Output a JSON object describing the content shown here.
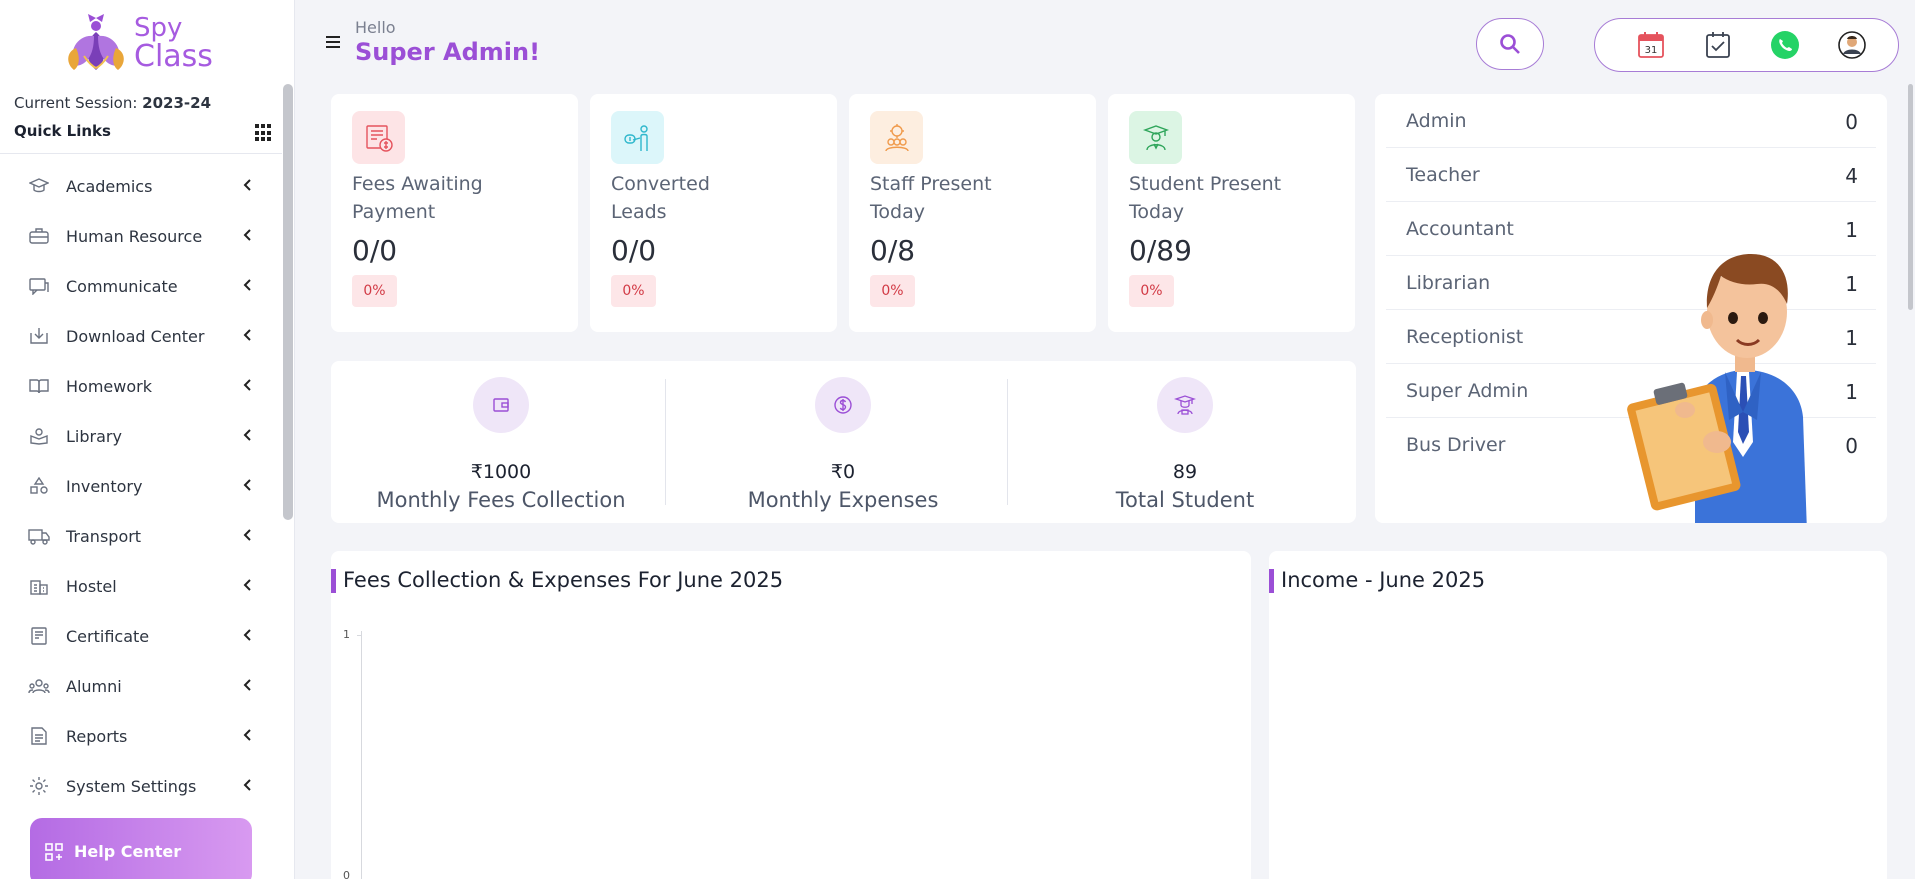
{
  "brand": {
    "line1": "Spy",
    "line2": "Class",
    "color": "#a65be0"
  },
  "session": {
    "label": "Current Session: ",
    "value": "2023-24"
  },
  "quick_links": "Quick Links",
  "menu": [
    {
      "label": "Academics",
      "icon": "graduation-cap-icon"
    },
    {
      "label": "Human Resource",
      "icon": "briefcase-icon"
    },
    {
      "label": "Communicate",
      "icon": "chat-icon"
    },
    {
      "label": "Download Center",
      "icon": "download-icon"
    },
    {
      "label": "Homework",
      "icon": "book-open-icon"
    },
    {
      "label": "Library",
      "icon": "library-icon"
    },
    {
      "label": "Inventory",
      "icon": "shapes-icon"
    },
    {
      "label": "Transport",
      "icon": "truck-icon"
    },
    {
      "label": "Hostel",
      "icon": "building-icon"
    },
    {
      "label": "Certificate",
      "icon": "certificate-icon"
    },
    {
      "label": "Alumni",
      "icon": "people-icon"
    },
    {
      "label": "Reports",
      "icon": "report-icon"
    },
    {
      "label": "System Settings",
      "icon": "gear-icon"
    }
  ],
  "help_center": "Help Center",
  "header": {
    "hello": "Hello",
    "user": "Super Admin!"
  },
  "toolbar": {
    "calendar_day": "31",
    "icons": [
      "calendar-icon",
      "task-check-icon",
      "whatsapp-icon",
      "user-avatar-icon"
    ]
  },
  "stats": [
    {
      "title_line1": "Fees Awaiting",
      "title_line2": "Payment",
      "value": "0/0",
      "percent": "0%",
      "icon": "fees-invoice-icon",
      "icon_bg": "#fde4e6",
      "icon_color": "#e5535d"
    },
    {
      "title_line1": "Converted",
      "title_line2": "Leads",
      "value": "0/0",
      "percent": "0%",
      "icon": "lead-presenter-icon",
      "icon_bg": "#dcf6fa",
      "icon_color": "#2eb7cc"
    },
    {
      "title_line1": "Staff Present",
      "title_line2": "Today",
      "value": "0/8",
      "percent": "0%",
      "icon": "staff-group-icon",
      "icon_bg": "#fdeee0",
      "icon_color": "#f09a4b"
    },
    {
      "title_line1": "Student Present",
      "title_line2": "Today",
      "value": "0/89",
      "percent": "0%",
      "icon": "student-icon",
      "icon_bg": "#dcf5e4",
      "icon_color": "#2ea55a"
    }
  ],
  "summary": [
    {
      "value": "₹1000",
      "label": "Monthly Fees Collection",
      "icon": "wallet-icon"
    },
    {
      "value": "₹0",
      "label": "Monthly Expenses",
      "icon": "dollar-coin-icon"
    },
    {
      "value": "89",
      "label": "Total Student",
      "icon": "graduate-icon"
    }
  ],
  "roles": [
    {
      "name": "Admin",
      "count": "0"
    },
    {
      "name": "Teacher",
      "count": "4"
    },
    {
      "name": "Accountant",
      "count": "1"
    },
    {
      "name": "Librarian",
      "count": "1"
    },
    {
      "name": "Receptionist",
      "count": "1"
    },
    {
      "name": "Super Admin",
      "count": "1"
    },
    {
      "name": "Bus Driver",
      "count": "0"
    }
  ],
  "panels": {
    "fees_title": "Fees Collection & Expenses For June 2025",
    "income_title": "Income - June 2025"
  },
  "chart_data": {
    "type": "line",
    "title": "Fees Collection & Expenses For June 2025",
    "y_ticks": [
      "1",
      "0"
    ],
    "ylim": [
      0,
      1
    ]
  }
}
